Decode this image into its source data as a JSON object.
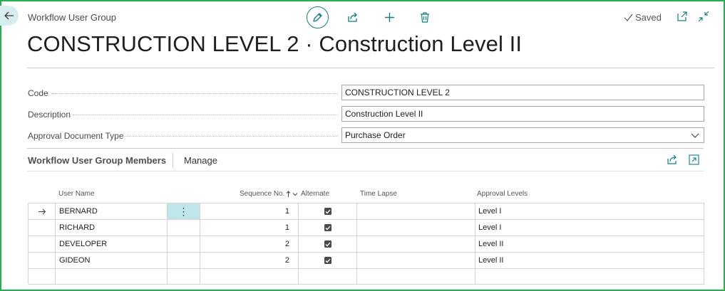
{
  "header": {
    "caption": "Workflow User Group",
    "saved_label": "Saved",
    "title": "CONSTRUCTION LEVEL 2 · Construction Level II"
  },
  "fields": {
    "code": {
      "label": "Code",
      "value": "CONSTRUCTION LEVEL 2"
    },
    "description": {
      "label": "Description",
      "value": "Construction Level II"
    },
    "approval_document_type": {
      "label": "Approval Document Type",
      "value": "Purchase Order"
    }
  },
  "members": {
    "title": "Workflow User Group Members",
    "manage_label": "Manage",
    "columns": {
      "user_name": "User Name",
      "sequence_no": "Sequence No.",
      "alternate": "Alternate",
      "time_lapse": "Time Lapse",
      "approval_levels": "Approval Levels"
    },
    "rows": [
      {
        "user_name": "BERNARD",
        "sequence_no": "1",
        "alternate": true,
        "time_lapse": "",
        "approval_level": "Level I"
      },
      {
        "user_name": "RICHARD",
        "sequence_no": "1",
        "alternate": true,
        "time_lapse": "",
        "approval_level": "Level I"
      },
      {
        "user_name": "DEVELOPER",
        "sequence_no": "2",
        "alternate": true,
        "time_lapse": "",
        "approval_level": "Level II"
      },
      {
        "user_name": "GIDEON",
        "sequence_no": "2",
        "alternate": true,
        "time_lapse": "",
        "approval_level": "Level II"
      }
    ]
  },
  "icons": {
    "back": "back-arrow-icon",
    "edit": "pencil-icon",
    "share": "share-icon",
    "new": "plus-icon",
    "delete": "trash-icon",
    "saved": "checkmark-icon",
    "open_new_window": "open-in-new-window-icon",
    "collapse": "collapse-icon",
    "sort": "sort-ascending-icon",
    "row_selector": "right-arrow-icon",
    "row_menu": "vertical-ellipsis-icon"
  },
  "colors": {
    "accent": "#0b7e88",
    "frame_border": "#22b14c",
    "active_cell": "#bfe6ea"
  }
}
